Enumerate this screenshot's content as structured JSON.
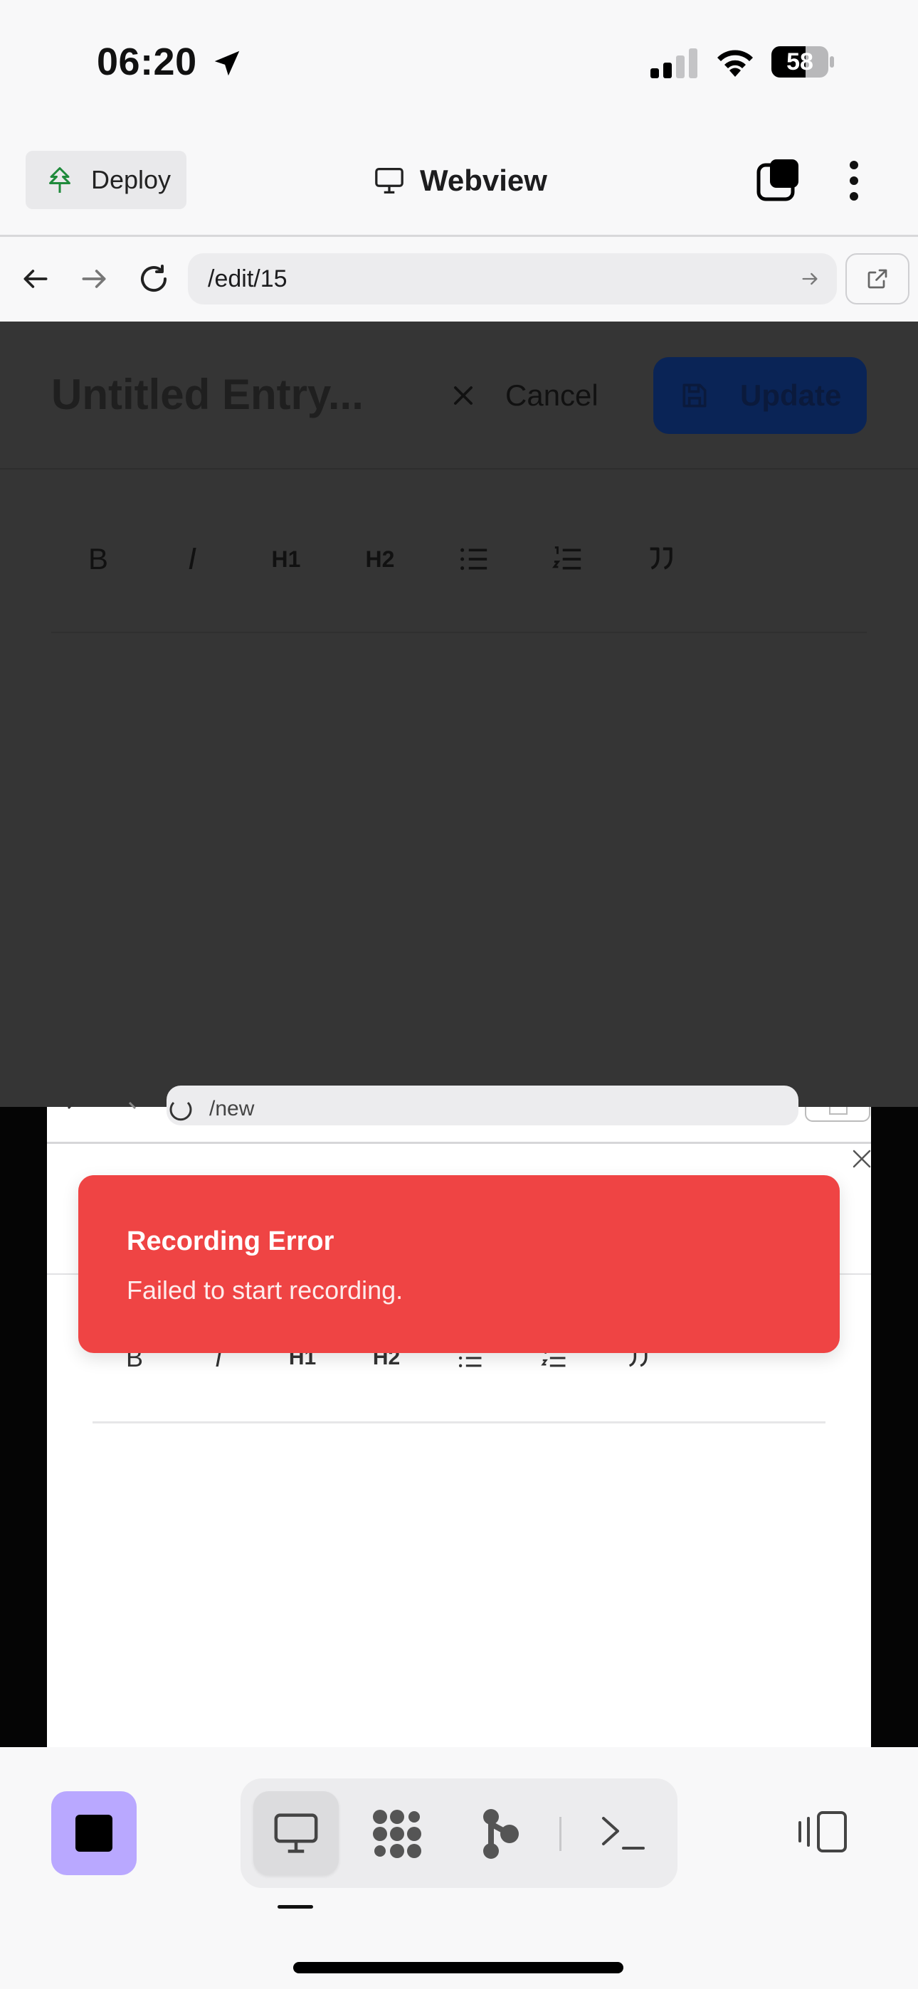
{
  "status_bar": {
    "time": "06:20",
    "battery": "58"
  },
  "top_bar": {
    "deploy_label": "Deploy",
    "title": "Webview"
  },
  "url_bar": {
    "path": "/edit/15"
  },
  "editor": {
    "title": "Untitled Entry...",
    "cancel_label": "Cancel",
    "update_label": "Update",
    "toolbar": [
      "B",
      "I",
      "H1",
      "H2",
      "bullet-list",
      "numbered-list",
      "quote"
    ]
  },
  "recording_preview": {
    "url_path": "/new"
  },
  "toast": {
    "title": "Recording Error",
    "description": "Failed to start recording.",
    "color": "#ef4444"
  },
  "bottom_bar": {
    "tabs": [
      "webview",
      "apps",
      "deploy-flow",
      "terminal"
    ],
    "active_tab": "webview",
    "stop_color": "#b9a8ff"
  }
}
